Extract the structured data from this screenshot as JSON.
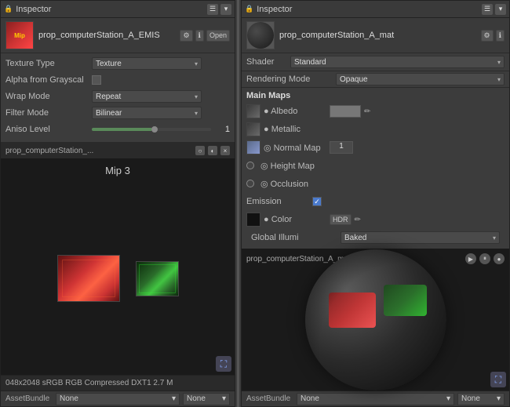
{
  "left_panel": {
    "header_title": "Inspector",
    "asset_name": "prop_computerStation_A_EMIS",
    "texture_type_label": "Texture Type",
    "texture_type_value": "Texture",
    "alpha_label": "Alpha from Grayscal",
    "wrap_mode_label": "Wrap Mode",
    "wrap_mode_value": "Repeat",
    "filter_mode_label": "Filter Mode",
    "filter_mode_value": "Bilinear",
    "aniso_label": "Aniso Level",
    "aniso_value": "1",
    "open_button": "Open",
    "mip_label": "Mip 3",
    "status_text": "048x2048 sRGB  RGB Compressed DXT1  2.7 M",
    "asset_bundle_label": "AssetBundle",
    "asset_bundle_value": "None",
    "asset_bundle_variant": "None"
  },
  "right_panel": {
    "header_title": "Inspector",
    "asset_name": "prop_computerStation_A_mat",
    "shader_label": "Shader",
    "shader_value": "Standard",
    "rendering_mode_label": "Rendering Mode",
    "rendering_mode_value": "Opaque",
    "main_maps_title": "Main Maps",
    "albedo_label": "● Albedo",
    "metallic_label": "● Metallic",
    "normal_map_label": "◎ Normal Map",
    "normal_map_value": "1",
    "height_map_label": "◎ Height Map",
    "occlusion_label": "◎ Occlusion",
    "emission_label": "Emission",
    "color_label": "● Color",
    "global_illum_label": "Global Illumi",
    "global_illum_value": "Baked",
    "preview_label": "prop_computerStation_A_ma",
    "asset_bundle_label": "AssetBundle",
    "asset_bundle_value": "None",
    "asset_bundle_variant": "None"
  }
}
